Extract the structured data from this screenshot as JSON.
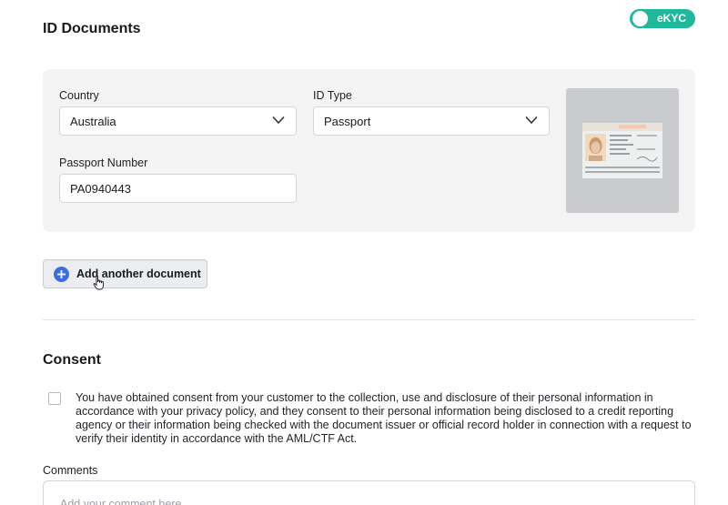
{
  "id_documents": {
    "title": "ID Documents",
    "ekyc_toggle": {
      "label": "eKYC",
      "on": true,
      "color": "#1fb89a"
    }
  },
  "document": {
    "country": {
      "label": "Country",
      "value": "Australia"
    },
    "id_type": {
      "label": "ID Type",
      "value": "Passport"
    },
    "passport_number": {
      "label": "Passport Number",
      "value": "PA0940443"
    }
  },
  "add_document_button": {
    "label": "Add another document",
    "icon": "plus-circle-icon",
    "icon_color": "#3b6fe0"
  },
  "consent": {
    "title": "Consent",
    "checkbox_checked": false,
    "text": "You have obtained consent from your customer to the collection, use and disclosure of their personal information in accordance with your privacy policy, and they consent to their personal information being disclosed to a credit reporting agency or their information being checked with the document issuer or official record holder in connection with a request to verify their identity in accordance with the AML/CTF Act."
  },
  "comments": {
    "label": "Comments",
    "placeholder": "Add your comment here"
  }
}
